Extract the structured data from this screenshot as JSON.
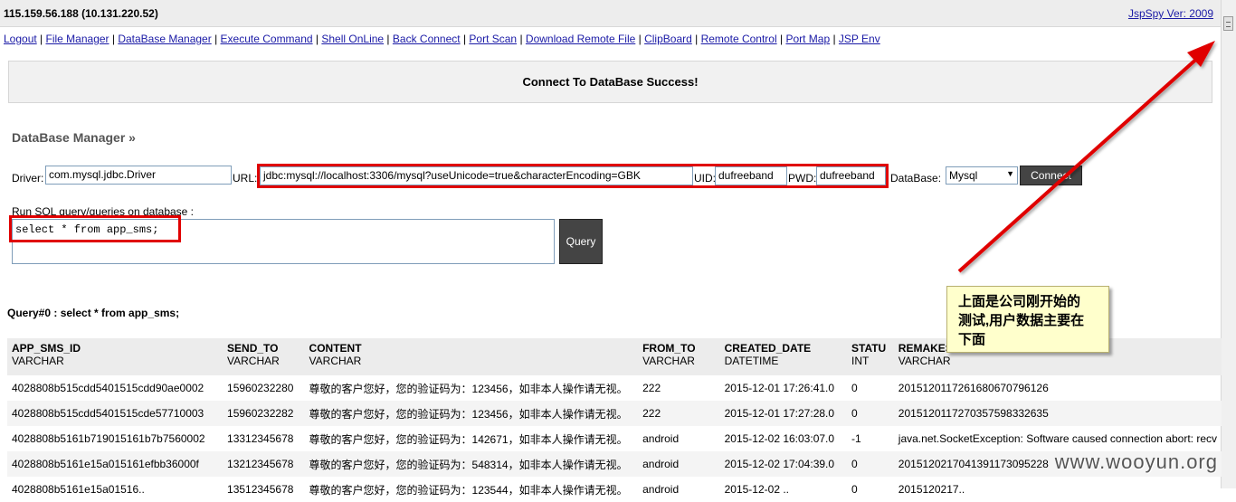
{
  "header": {
    "host": "115.159.56.188 (10.131.220.52)",
    "version_link": "JspSpy Ver: 2009"
  },
  "nav": [
    "Logout",
    "File Manager",
    "DataBase Manager",
    "Execute Command",
    "Shell OnLine",
    "Back Connect",
    "Port Scan",
    "Download Remote File",
    "ClipBoard",
    "Remote Control",
    "Port Map",
    "JSP Env"
  ],
  "status": {
    "message": "Connect To DataBase Success!"
  },
  "db": {
    "title": "DataBase Manager »",
    "driver_label": "Driver:",
    "driver_value": "com.mysql.jdbc.Driver",
    "url_label": "URL:",
    "url_value": "jdbc:mysql://localhost:3306/mysql?useUnicode=true&characterEncoding=GBK",
    "uid_label": "UID:",
    "uid_value": "dufreeband",
    "pwd_label": "PWD:",
    "pwd_value": "dufreeband",
    "database_label": "DataBase:",
    "database_value": "Mysql",
    "connect_label": "Connect",
    "sql_label": "Run SQL query/queries on database :",
    "sql_value": "select * from app_sms;",
    "query_button": "Query"
  },
  "result": {
    "title": "Query#0 : select * from app_sms;",
    "columns": [
      {
        "name": "APP_SMS_ID",
        "type": "VARCHAR"
      },
      {
        "name": "SEND_TO",
        "type": "VARCHAR"
      },
      {
        "name": "CONTENT",
        "type": "VARCHAR"
      },
      {
        "name": "FROM_TO",
        "type": "VARCHAR"
      },
      {
        "name": "CREATED_DATE",
        "type": "DATETIME"
      },
      {
        "name": "STATU",
        "type": "INT"
      },
      {
        "name": "REMAKES",
        "type": "VARCHAR"
      }
    ],
    "rows": [
      [
        "4028808b515cdd5401515cdd90ae0002",
        "15960232280",
        "尊敬的客户您好，您的验证码为：123456，如非本人操作请无视。",
        "222",
        "2015-12-01 17:26:41.0",
        "0",
        "20151201172616806707961​26"
      ],
      [
        "4028808b515cdd5401515cde57710003",
        "15960232282",
        "尊敬的客户您好，您的验证码为：123456，如非本人操作请无视。",
        "222",
        "2015-12-01 17:27:28.0",
        "0",
        "20151201172703575983326​35"
      ],
      [
        "4028808b5161b719015161b7b7560002",
        "13312345678",
        "尊敬的客户您好，您的验证码为：142671，如非本人操作请无视。",
        "android",
        "2015-12-02 16:03:07.0",
        "-1",
        "java.net.SocketException: Software caused connection abort: recv"
      ],
      [
        "4028808b5161e15a015161efbb36000f",
        "13212345678",
        "尊敬的客户您好，您的验证码为：548314，如非本人操作请无视。",
        "android",
        "2015-12-02 17:04:39.0",
        "0",
        "20151202170413911730952​28"
      ],
      [
        "4028808b5161e15a01516..",
        "13512345678",
        "尊敬的客户您好，您的验证码为：123544，如非本人操作请无视。",
        "android",
        "2015-12-02 ..",
        "0",
        "2015120217.."
      ]
    ]
  },
  "annotation": {
    "line1": "上面是公司刚开始的",
    "line2": "测试,用户数据主要在",
    "line3": "下面"
  },
  "watermark": "www.wooyun.org",
  "colors": {
    "link": "#1a1aa6",
    "highlight": "#e00000",
    "note_bg": "#ffffcc"
  }
}
